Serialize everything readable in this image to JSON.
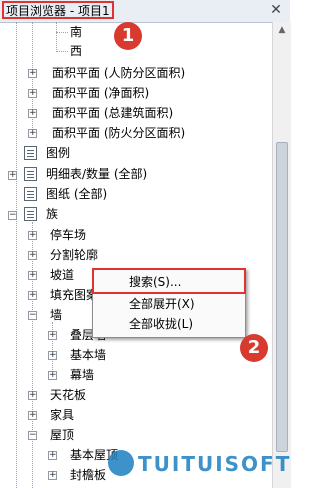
{
  "window": {
    "title": "项目浏览器 - 项目1",
    "close_glyph": "✕"
  },
  "tree": {
    "south": "南",
    "west": "西",
    "area_civil": "面积平面 (人防分区面积)",
    "area_net": "面积平面 (净面积)",
    "area_total": "面积平面 (总建筑面积)",
    "area_fire": "面积平面 (防火分区面积)",
    "legend": "图例",
    "schedules": "明细表/数量 (全部)",
    "sheets": "图纸 (全部)",
    "families": "族",
    "parking": "停车场",
    "profile": "分割轮廓",
    "ramp": "坡道",
    "fill_pattern": "填充图案",
    "wall": "墙",
    "stacked_wall": "叠层墙",
    "basic_wall": "基本墙",
    "curtain_wall": "幕墙",
    "ceiling": "天花板",
    "furniture": "家具",
    "roof": "屋顶",
    "basic_roof": "基本屋顶",
    "fascia": "封檐板"
  },
  "context_menu": {
    "search": "搜索(S)...",
    "expand_all": "全部展开(X)",
    "collapse_all": "全部收拢(L)"
  },
  "annotations": {
    "badge1": "1",
    "badge2": "2",
    "highlight_color": "#e03232"
  },
  "watermark": {
    "text": "TUITUISOFT"
  }
}
